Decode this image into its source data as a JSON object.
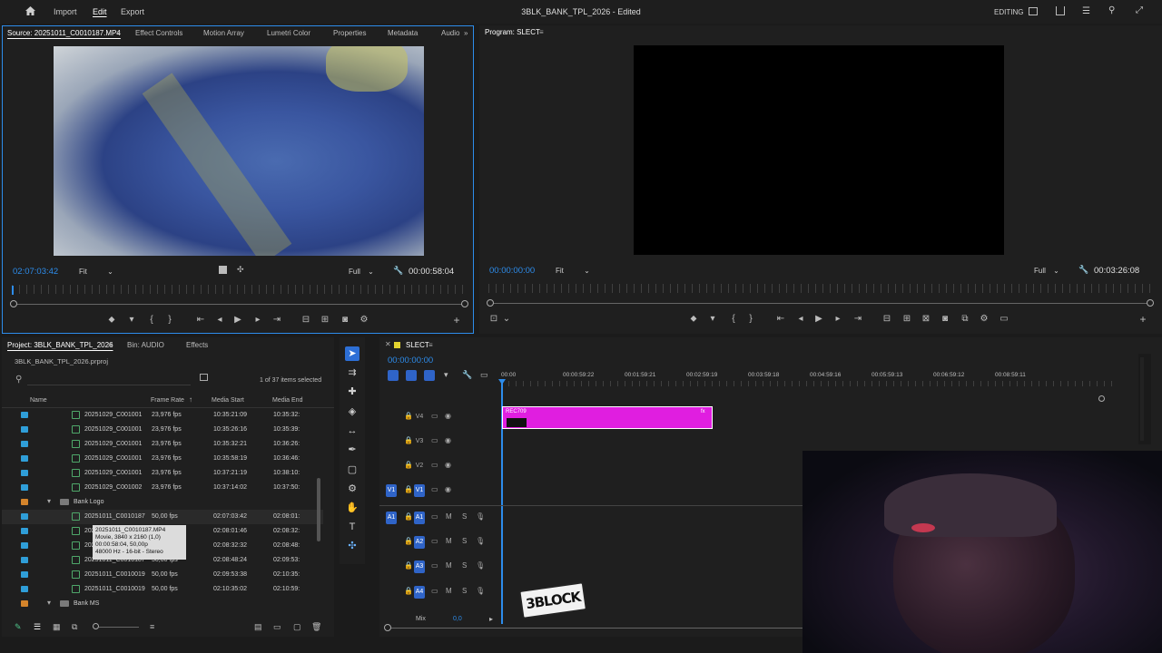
{
  "app": {
    "title": "3BLK_BANK_TPL_2026 - Edited",
    "menu": [
      "Import",
      "Edit",
      "Export"
    ],
    "workspace": "EDITING"
  },
  "source": {
    "tab_source": "Source: 20251011_C0010187.MP4",
    "tabs": [
      "Effect Controls",
      "Motion Array",
      "Lumetri Color",
      "Properties",
      "Metadata",
      "Audio"
    ],
    "timecode": "02:07:03:42",
    "fit": "Fit",
    "quality": "Full",
    "duration": "00:00:58:04"
  },
  "program": {
    "tab": "Program: SLECT",
    "timecode": "00:00:00:00",
    "fit": "Fit",
    "quality": "Full",
    "duration": "00:03:26:08"
  },
  "project": {
    "tab": "Project: 3BLK_BANK_TPL_2026",
    "tab2": "Bin: AUDIO",
    "tab3": "Effects",
    "file": "3BLK_BANK_TPL_2026.prproj",
    "selection": "1 of 37 items selected",
    "columns": [
      "Name",
      "Frame Rate",
      "Media Start",
      "Media End"
    ],
    "rows": [
      {
        "name": "20251029_C001001",
        "rate": "23,976 fps",
        "start": "10:35:21:09",
        "end": "10:35:32:",
        "label": "blue"
      },
      {
        "name": "20251029_C001001",
        "rate": "23,976 fps",
        "start": "10:35:26:16",
        "end": "10:35:39:",
        "label": "blue"
      },
      {
        "name": "20251029_C001001",
        "rate": "23,976 fps",
        "start": "10:35:32:21",
        "end": "10:36:26:",
        "label": "blue"
      },
      {
        "name": "20251029_C001001",
        "rate": "23,976 fps",
        "start": "10:35:58:19",
        "end": "10:36:46:",
        "label": "blue"
      },
      {
        "name": "20251029_C001001",
        "rate": "23,976 fps",
        "start": "10:37:21:19",
        "end": "10:38:10:",
        "label": "blue"
      },
      {
        "name": "20251029_C001002",
        "rate": "23,976 fps",
        "start": "10:37:14:02",
        "end": "10:37:50:",
        "label": "blue"
      },
      {
        "name": "20251011_C0010187",
        "rate": "50,00 fps",
        "start": "02:07:03:42",
        "end": "02:08:01:",
        "label": "blue"
      },
      {
        "name": "20251011_C0010187",
        "rate": "50,00 fps",
        "start": "02:08:01:46",
        "end": "02:08:32:",
        "label": "blue"
      },
      {
        "name": "20251011_C0010187",
        "rate": "50,00 fps",
        "start": "02:08:32:32",
        "end": "02:08:48:",
        "label": "blue"
      },
      {
        "name": "20251011_C0010187",
        "rate": "50,00 fps",
        "start": "02:08:48:24",
        "end": "02:09:53:",
        "label": "blue"
      },
      {
        "name": "20251011_C0010019",
        "rate": "50,00 fps",
        "start": "02:09:53:38",
        "end": "02:10:35:",
        "label": "blue"
      },
      {
        "name": "20251011_C0010019",
        "rate": "50,00 fps",
        "start": "02:10:35:02",
        "end": "02:10:59:",
        "label": "blue"
      }
    ],
    "bin_bank_logo": "Bank Logo",
    "bin_bank_ms": "Bank MS",
    "tooltip": [
      "20251011_C0010187.MP4",
      "Movie, 3840 x 2160 (1,0)",
      "00:00:58:04, 50,00p",
      "48000 Hz - 16-bit - Stereo"
    ]
  },
  "timeline": {
    "tab": "SLECT",
    "timecode": "00:00:00:00",
    "ruler": [
      "00:00",
      "00:00:59:22",
      "00:01:59:21",
      "00:02:59:19",
      "00:03:59:18",
      "00:04:59:16",
      "00:05:59:13",
      "00:06:59:12",
      "00:08:59:11"
    ],
    "video_tracks": [
      "V4",
      "V3",
      "V2",
      "V1"
    ],
    "audio_tracks": [
      "A1",
      "A2",
      "A3",
      "A4"
    ],
    "mix_label": "Mix",
    "mix_value": "0,0",
    "clip_label": "REC709",
    "clip_color": "#e01ee0",
    "logo_text": "3BLOCK"
  },
  "colors": {
    "accent": "#2d8ceb",
    "clip": "#e01ee0"
  }
}
